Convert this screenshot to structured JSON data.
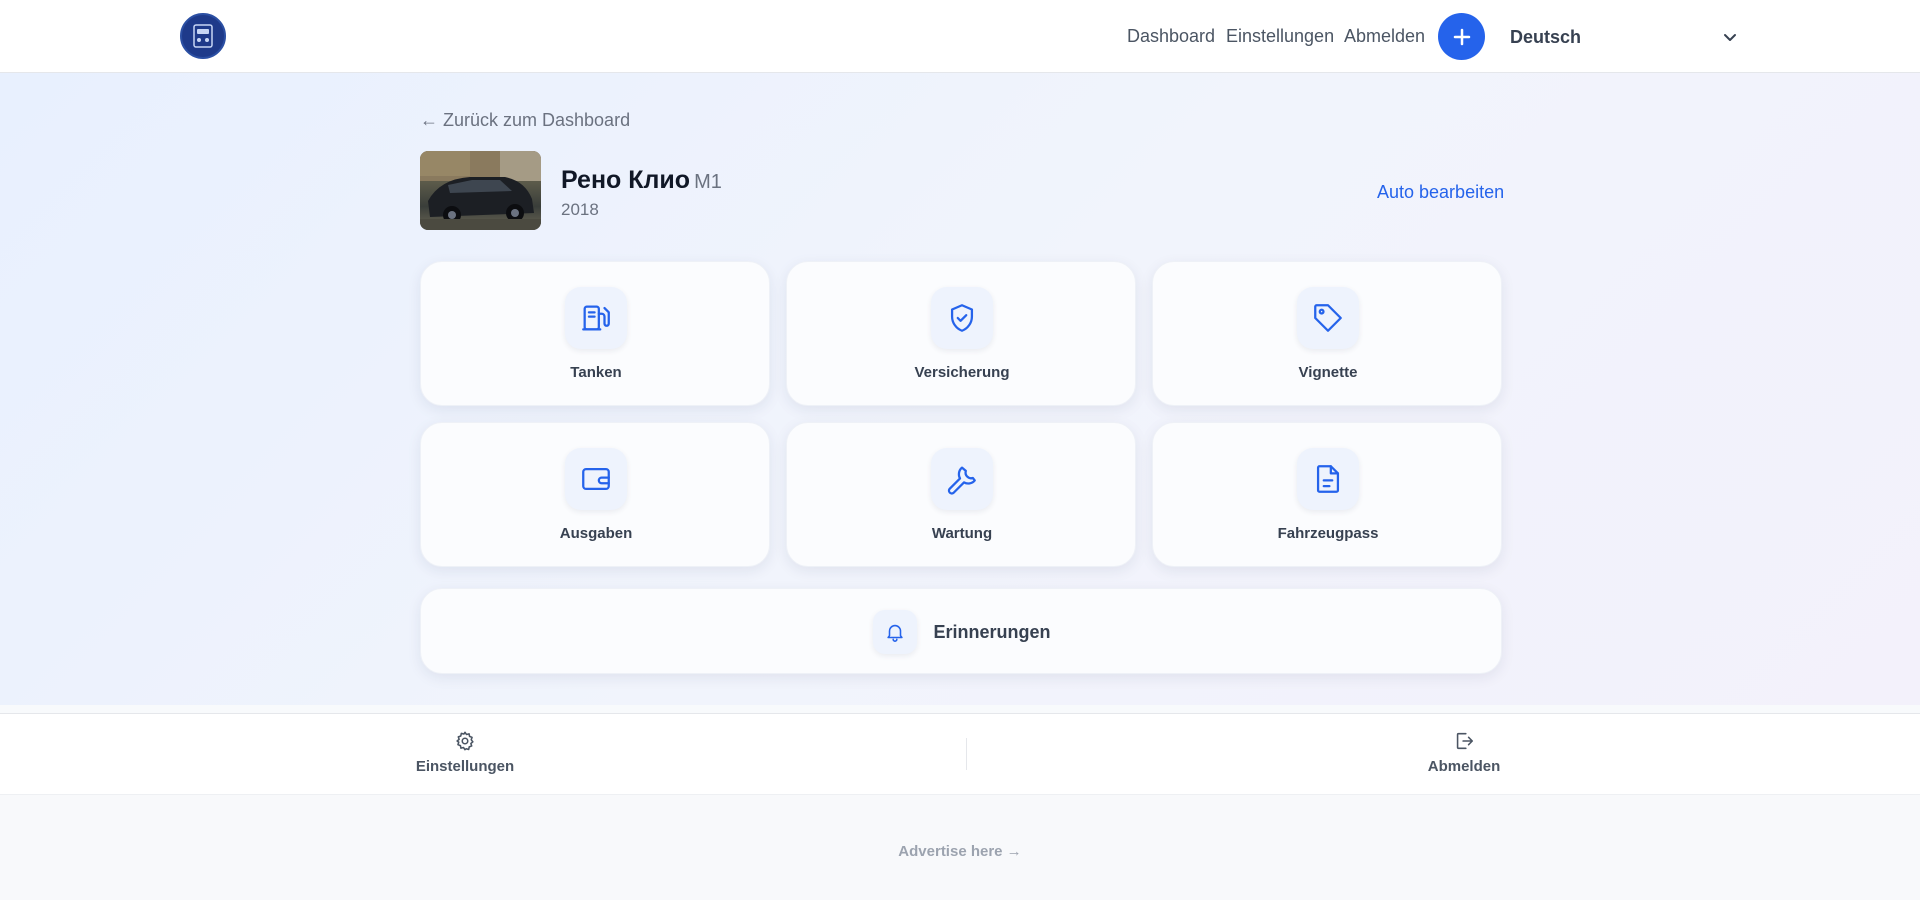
{
  "header": {
    "nav": {
      "dashboard": "Dashboard",
      "settings": "Einstellungen",
      "logout": "Abmelden"
    },
    "language": "Deutsch"
  },
  "main": {
    "back_link": "← Zurück zum Dashboard",
    "car": {
      "name": "Рено Клио",
      "plate": "M1",
      "year": "2018"
    },
    "edit_link": "Auto bearbeiten",
    "tiles": [
      {
        "label": "Tanken",
        "icon": "fuel-pump-icon"
      },
      {
        "label": "Versicherung",
        "icon": "shield-check-icon"
      },
      {
        "label": "Vignette",
        "icon": "tag-icon"
      },
      {
        "label": "Ausgaben",
        "icon": "wallet-icon"
      },
      {
        "label": "Wartung",
        "icon": "wrench-icon"
      },
      {
        "label": "Fahrzeugpass",
        "icon": "document-icon"
      }
    ],
    "reminders": {
      "label": "Erinnerungen",
      "icon": "bell-icon"
    }
  },
  "bottom_nav": {
    "settings": "Einstellungen",
    "logout": "Abmelden"
  },
  "ad": "Advertise here →",
  "colors": {
    "accent": "#2563eb",
    "logo_bg": "#1e3a8a"
  }
}
